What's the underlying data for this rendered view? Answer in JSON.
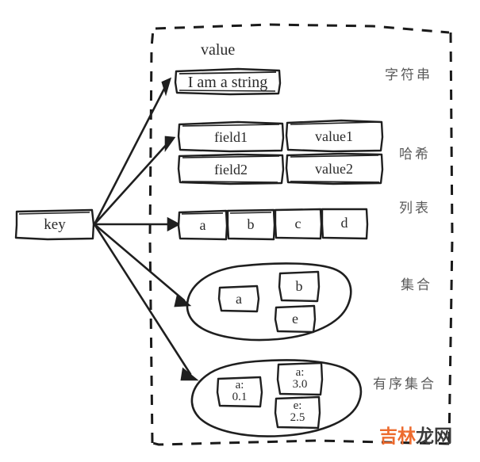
{
  "diagram": {
    "title_caption": "value",
    "key_box": {
      "label": "key"
    },
    "border": {
      "style": "dashed",
      "color": "#1a1a1a"
    },
    "colors": {
      "ink": "#1f1f1f",
      "text": "#2b2b2b",
      "cn_label": "#5a5a5a",
      "watermark_orange": "#ED6B2E",
      "watermark_dark": "#3b3b3b",
      "background": "#ffffff"
    },
    "types": [
      {
        "id": "string",
        "cn_label": "字符串",
        "shape": "single-box",
        "cells": [
          "I am a string"
        ]
      },
      {
        "id": "hash",
        "cn_label": "哈希",
        "shape": "two-column-table",
        "rows": [
          {
            "field": "field1",
            "value": "value1"
          },
          {
            "field": "field2",
            "value": "value2"
          }
        ]
      },
      {
        "id": "list",
        "cn_label": "列表",
        "shape": "row-of-boxes",
        "cells": [
          "a",
          "b",
          "c",
          "d"
        ]
      },
      {
        "id": "set",
        "cn_label": "集合",
        "shape": "ellipse-with-boxes",
        "cells": [
          "a",
          "b",
          "e"
        ]
      },
      {
        "id": "sorted-set",
        "cn_label": "有序集合",
        "shape": "ellipse-with-boxes",
        "cells": [
          "a:\n0.1",
          "a:\n3.0",
          "e:\n2.5"
        ]
      }
    ],
    "watermark": {
      "part1": "吉林",
      "part2": "龙网"
    }
  }
}
